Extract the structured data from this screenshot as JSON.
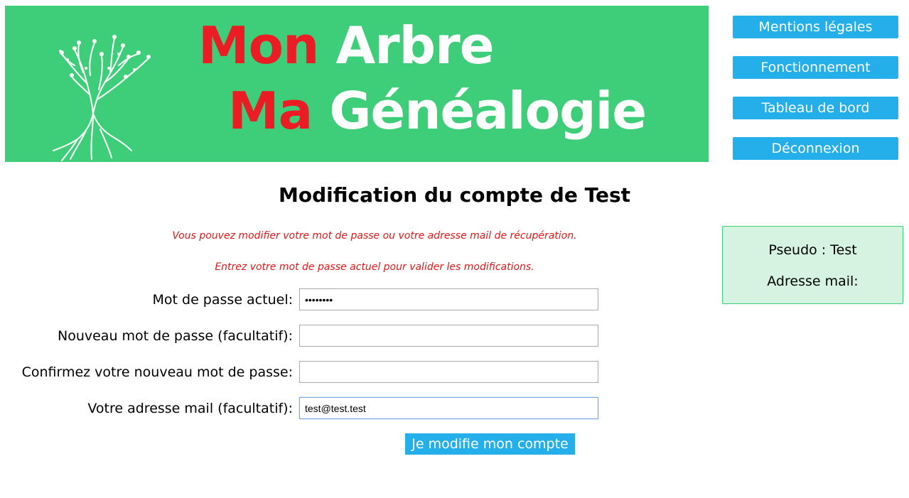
{
  "banner": {
    "line1_word1": "Mon",
    "line1_word2": "Arbre",
    "line2_word1": "Ma",
    "line2_word2": "Généalogie",
    "logo_icon": "tree-icon"
  },
  "colors": {
    "banner_bg": "#3ecd78",
    "accent_red": "#ec1c24",
    "button_blue": "#24aeea",
    "panel_bg": "#d6f3e1"
  },
  "nav": {
    "items": [
      {
        "label": "Mentions légales"
      },
      {
        "label": "Fonctionnement"
      },
      {
        "label": "Tableau de bord"
      },
      {
        "label": "Déconnexion"
      }
    ]
  },
  "main": {
    "title": "Modification du compte de Test",
    "notice1": "Vous pouvez modifier votre mot de passe ou votre adresse mail de récupération.",
    "notice2": "Entrez votre mot de passe actuel pour valider les modifications.",
    "fields": [
      {
        "label": "Mot de passe actuel:",
        "value": "test1234",
        "type": "password"
      },
      {
        "label": "Nouveau mot de passe (facultatif):",
        "value": "",
        "type": "password"
      },
      {
        "label": "Confirmez votre nouveau mot de passe:",
        "value": "",
        "type": "password"
      },
      {
        "label": "Votre adresse mail (facultatif):",
        "value": "test@test.test",
        "type": "text"
      }
    ],
    "submit_label": "Je modifie mon compte"
  },
  "info": {
    "pseudo": "Pseudo : Test",
    "mail": "Adresse mail:"
  }
}
